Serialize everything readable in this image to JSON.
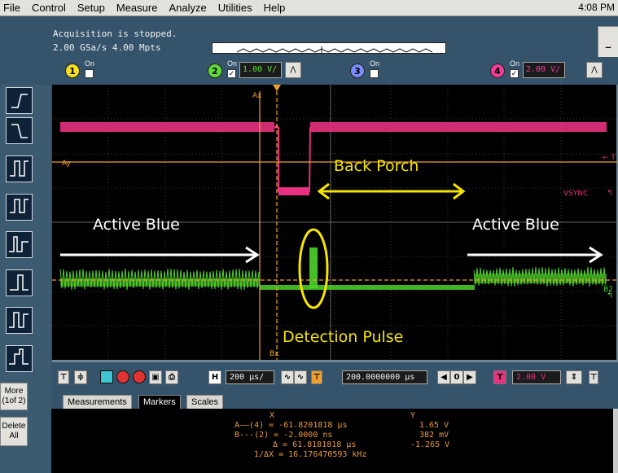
{
  "menu": {
    "items": [
      "File",
      "Control",
      "Setup",
      "Measure",
      "Analyze",
      "Utilities",
      "Help"
    ],
    "clock": "4:08 PM"
  },
  "status": {
    "acquisition": "Acquisition is stopped.",
    "rate_depth": "2.00 GSa/s   4.00 Mpts",
    "minimize_label": "_"
  },
  "channels": [
    {
      "num": "1",
      "on_label": "On",
      "checked": false,
      "color": "#f5e020"
    },
    {
      "num": "2",
      "on_label": "On",
      "checked": true,
      "scale": "1.00 V/",
      "color": "#5fdc35"
    },
    {
      "num": "3",
      "on_label": "On",
      "checked": false,
      "color": "#7a8cff"
    },
    {
      "num": "4",
      "on_label": "On",
      "checked": true,
      "scale": "2.00 V/",
      "color": "#f03e9a"
    }
  ],
  "left_toolbar": {
    "more_label_1": "More",
    "more_label_2": "(1of 2)",
    "delete_label_1": "Delete",
    "delete_label_2": "All"
  },
  "display": {
    "marker_ax_label": "Ax",
    "marker_ay_label": "Ay",
    "marker_bx_label": "Bx",
    "right_tick_label": "← T",
    "vsync_label": "VSYNC",
    "b2_label": "B2",
    "ch4_marker": "⁴",
    "ch2_marker": "²",
    "annotations": {
      "back_porch": "Back Porch",
      "active_blue_left": "Active Blue",
      "active_blue_right": "Active Blue",
      "detection_pulse": "Detection Pulse"
    },
    "colors": {
      "ch4_trace": "#e8317f",
      "ch2_trace": "#4fd12b",
      "marker": "#f0a030",
      "annotation_yellow": "#f5e400",
      "arrow_white": "#ffffff"
    }
  },
  "horizontal": {
    "h_label": "H",
    "timebase": "200 µs/",
    "position": "200.0000000 µs",
    "nav_label": "0",
    "t_label": "T",
    "trigger_level": "2.00 V"
  },
  "tabs": {
    "measurements": "Measurements",
    "markers": "Markers",
    "scales": "Scales"
  },
  "readout": {
    "col_x": "X",
    "col_y": "Y",
    "row_a": "A——(4) = -61.8201818 µs",
    "row_a_y": "1.65 V",
    "row_b": "B---(2) = -2.0000 ns",
    "row_b_y": "382 mV",
    "row_delta": "Δ = 61.8181818 µs",
    "row_delta_y": "-1.265 V",
    "row_inv": "1/ΔX = 16.176470593 kHz"
  }
}
